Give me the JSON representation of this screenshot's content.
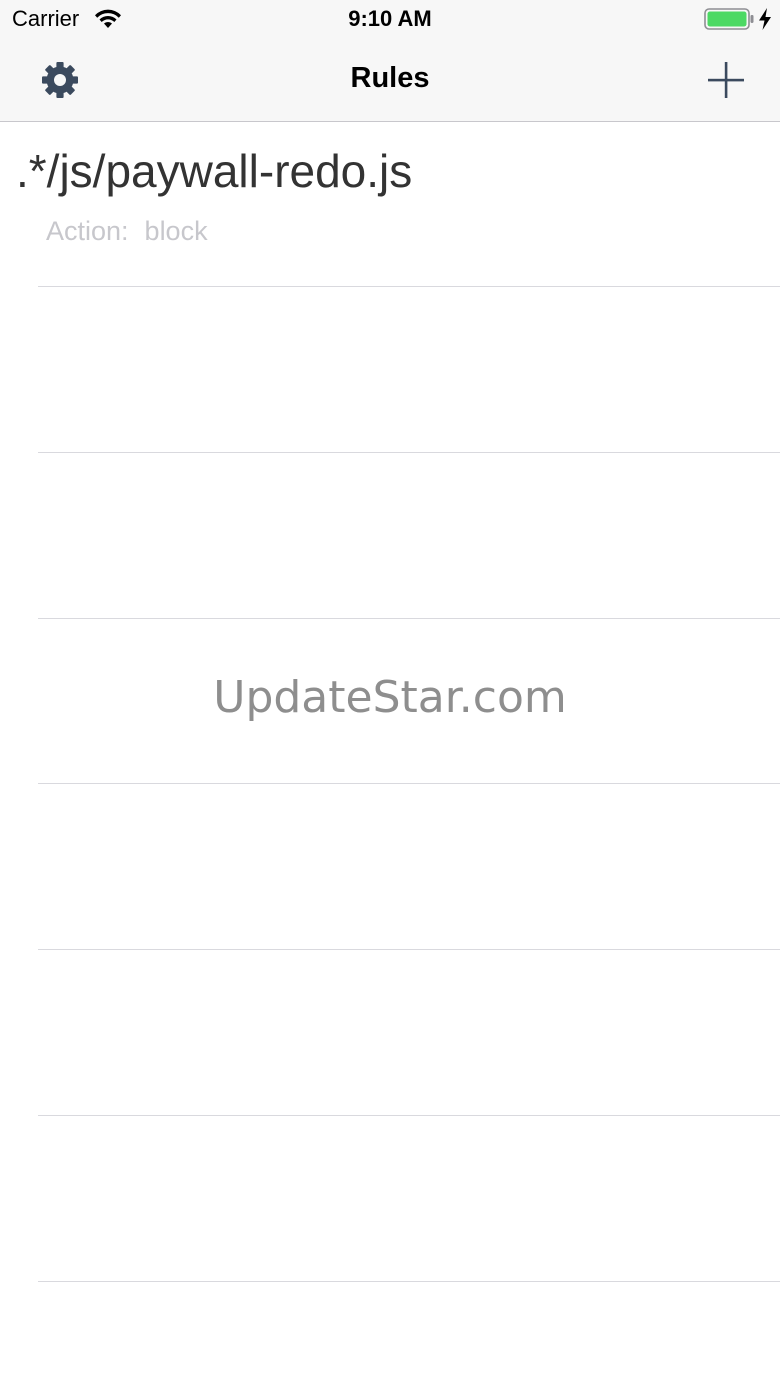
{
  "status_bar": {
    "carrier": "Carrier",
    "time": "9:10 AM",
    "wifi_icon": "wifi-icon",
    "battery_icon": "battery-icon",
    "battery_level": 1.0,
    "battery_color": "#4cd964",
    "charging_icon": "bolt-icon"
  },
  "nav_bar": {
    "title": "Rules",
    "left_icon": "gear-icon",
    "right_icon": "plus-icon",
    "icon_color": "#3b4a5e"
  },
  "rules": [
    {
      "pattern": ".*/js/paywall-redo.js",
      "action_label": "Action:",
      "action_value": "block"
    }
  ],
  "watermark": "UpdateStar.com"
}
